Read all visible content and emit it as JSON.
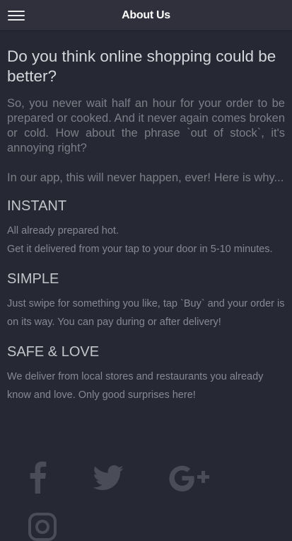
{
  "header": {
    "title": "About Us",
    "menu_icon": "hamburger-menu-icon"
  },
  "main": {
    "lead": "Do you think online shopping could be better?",
    "intro_paragraphs": [
      "So, you never wait half an hour for your order to be prepared or cooked. And it never again comes broken or cold. How about the phrase `out of stock`, it's annoying right?",
      "In our app, this will never happen, ever! Here is why..."
    ],
    "sections": [
      {
        "heading": "INSTANT",
        "lines": [
          "All already prepared   hot.",
          "Get it delivered from your tap to your door in 5-10 minutes."
        ]
      },
      {
        "heading": "SIMPLE",
        "lines": [
          "Just swipe for something you like, tap `Buy` and your order is on its way. You can pay during or after delivery!"
        ]
      },
      {
        "heading": "SAFE & LOVE",
        "lines": [
          "We deliver from local stores and restaurants you already know and love. Only good surprises here!"
        ]
      }
    ]
  },
  "social": {
    "icons": [
      "facebook-icon",
      "twitter-icon",
      "google-plus-icon",
      "instagram-icon"
    ],
    "icon_color": "#4a4c57"
  },
  "colors": {
    "background": "#262833",
    "header": "#2f303b",
    "heading_text": "#d6d7dc",
    "body_text": "#7c7e88"
  }
}
